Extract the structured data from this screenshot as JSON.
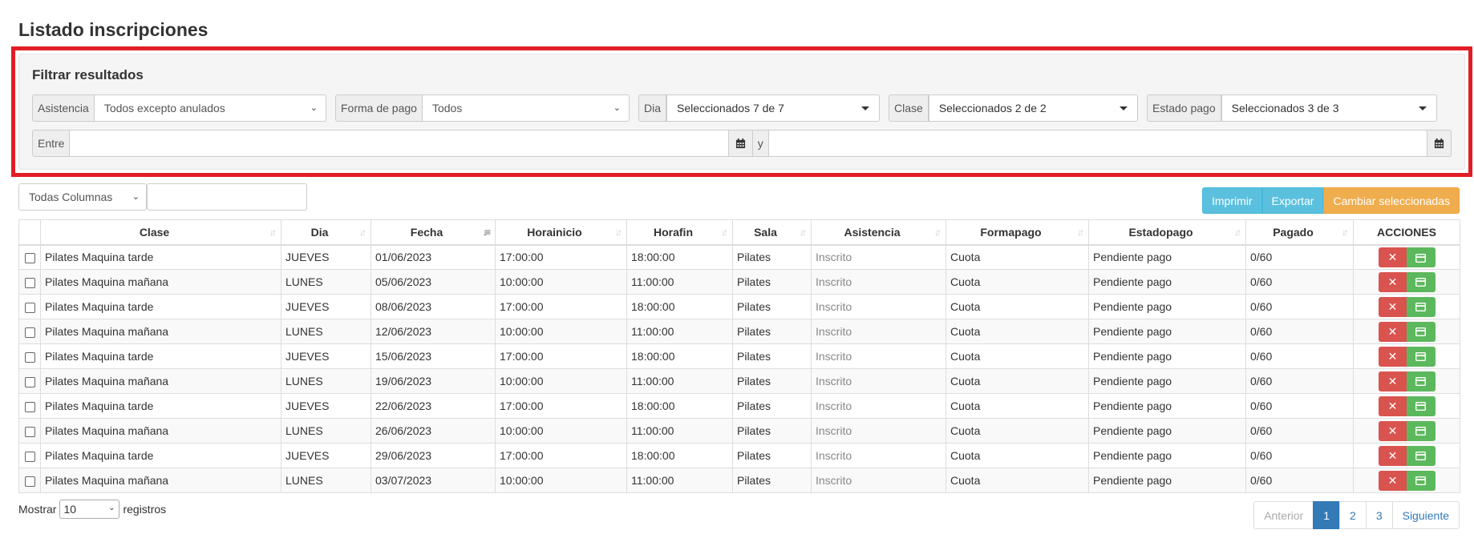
{
  "title": "Listado inscripciones",
  "filter": {
    "title": "Filtrar resultados",
    "asistencia": {
      "label": "Asistencia",
      "value": "Todos excepto anulados"
    },
    "formapago": {
      "label": "Forma de pago",
      "value": "Todos"
    },
    "dia": {
      "label": "Dia",
      "value": "Seleccionados 7 de 7"
    },
    "clase": {
      "label": "Clase",
      "value": "Seleccionados 2 de 2"
    },
    "estadopago": {
      "label": "Estado pago",
      "value": "Seleccionados 3 de 3"
    },
    "entre_label": "Entre",
    "y_label": "y"
  },
  "toolbar": {
    "column_select": "Todas Columnas",
    "search_value": "",
    "print_label": "Imprimir",
    "export_label": "Exportar",
    "change_label": "Cambiar seleccionadas"
  },
  "table": {
    "headers": [
      "Clase",
      "Dia",
      "Fecha",
      "Horainicio",
      "Horafin",
      "Sala",
      "Asistencia",
      "Formapago",
      "Estadopago",
      "Pagado",
      "ACCIONES"
    ],
    "rows": [
      [
        "Pilates Maquina tarde",
        "JUEVES",
        "01/06/2023",
        "17:00:00",
        "18:00:00",
        "Pilates",
        "Inscrito",
        "Cuota",
        "Pendiente pago",
        "0/60"
      ],
      [
        "Pilates Maquina mañana",
        "LUNES",
        "05/06/2023",
        "10:00:00",
        "11:00:00",
        "Pilates",
        "Inscrito",
        "Cuota",
        "Pendiente pago",
        "0/60"
      ],
      [
        "Pilates Maquina tarde",
        "JUEVES",
        "08/06/2023",
        "17:00:00",
        "18:00:00",
        "Pilates",
        "Inscrito",
        "Cuota",
        "Pendiente pago",
        "0/60"
      ],
      [
        "Pilates Maquina mañana",
        "LUNES",
        "12/06/2023",
        "10:00:00",
        "11:00:00",
        "Pilates",
        "Inscrito",
        "Cuota",
        "Pendiente pago",
        "0/60"
      ],
      [
        "Pilates Maquina tarde",
        "JUEVES",
        "15/06/2023",
        "17:00:00",
        "18:00:00",
        "Pilates",
        "Inscrito",
        "Cuota",
        "Pendiente pago",
        "0/60"
      ],
      [
        "Pilates Maquina mañana",
        "LUNES",
        "19/06/2023",
        "10:00:00",
        "11:00:00",
        "Pilates",
        "Inscrito",
        "Cuota",
        "Pendiente pago",
        "0/60"
      ],
      [
        "Pilates Maquina tarde",
        "JUEVES",
        "22/06/2023",
        "17:00:00",
        "18:00:00",
        "Pilates",
        "Inscrito",
        "Cuota",
        "Pendiente pago",
        "0/60"
      ],
      [
        "Pilates Maquina mañana",
        "LUNES",
        "26/06/2023",
        "10:00:00",
        "11:00:00",
        "Pilates",
        "Inscrito",
        "Cuota",
        "Pendiente pago",
        "0/60"
      ],
      [
        "Pilates Maquina tarde",
        "JUEVES",
        "29/06/2023",
        "17:00:00",
        "18:00:00",
        "Pilates",
        "Inscrito",
        "Cuota",
        "Pendiente pago",
        "0/60"
      ],
      [
        "Pilates Maquina mañana",
        "LUNES",
        "03/07/2023",
        "10:00:00",
        "11:00:00",
        "Pilates",
        "Inscrito",
        "Cuota",
        "Pendiente pago",
        "0/60"
      ]
    ],
    "delete_icon": "close-icon",
    "confirm_icon": "card-icon"
  },
  "footer": {
    "show_label": "Mostrar",
    "page_size": "10",
    "records_label": "registros"
  },
  "pagination": {
    "prev": "Anterior",
    "pages": [
      "1",
      "2",
      "3"
    ],
    "active_page": "1",
    "next": "Siguiente"
  },
  "colors": {
    "highlight_border": "#e21d25",
    "info": "#5bc0de",
    "warning": "#f0ad4e",
    "danger": "#d9534f",
    "success": "#5cb85c",
    "primary": "#337ab7"
  }
}
